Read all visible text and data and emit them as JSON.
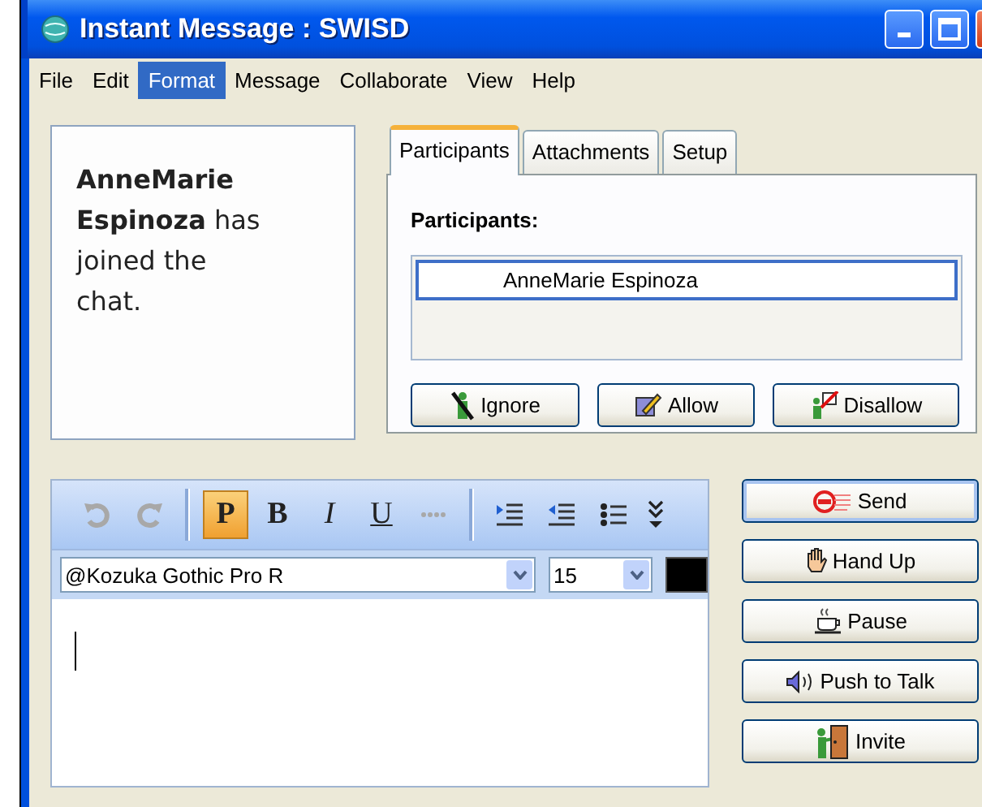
{
  "window": {
    "title": "Instant Message : SWISD"
  },
  "menu": [
    {
      "label": "File",
      "selected": false
    },
    {
      "label": "Edit",
      "selected": false
    },
    {
      "label": "Format",
      "selected": true
    },
    {
      "label": "Message",
      "selected": false
    },
    {
      "label": "Collaborate",
      "selected": false
    },
    {
      "label": "View",
      "selected": false
    },
    {
      "label": "Help",
      "selected": false
    }
  ],
  "chat": {
    "message": "**AnneMarie Espinoza** has joined the chat."
  },
  "tabs": [
    {
      "label": "Participants",
      "selected": true
    },
    {
      "label": "Attachments",
      "selected": false
    },
    {
      "label": "Setup",
      "selected": false
    }
  ],
  "participants": {
    "heading": "Participants:",
    "items": [
      {
        "name": "AnneMarie Espinoza",
        "selected": true
      }
    ],
    "buttons": [
      "Ignore",
      "Allow",
      "Disallow"
    ]
  },
  "toolbar": [
    {
      "kind": "undo",
      "disabled": true,
      "selected": false
    },
    {
      "kind": "redo",
      "disabled": true,
      "selected": false
    },
    {
      "kind": "sep"
    },
    {
      "kind": "plain",
      "label": "P",
      "disabled": false,
      "selected": true
    },
    {
      "kind": "bold",
      "label": "B",
      "disabled": false,
      "selected": false
    },
    {
      "kind": "italic",
      "label": "I",
      "disabled": false,
      "selected": false
    },
    {
      "kind": "underline",
      "label": "U",
      "disabled": false,
      "selected": false
    },
    {
      "kind": "quote",
      "disabled": true,
      "selected": false
    },
    {
      "kind": "sep"
    },
    {
      "kind": "indent",
      "selected": false
    },
    {
      "kind": "outdent",
      "selected": false
    },
    {
      "kind": "bullets",
      "selected": false
    },
    {
      "kind": "more",
      "selected": false
    }
  ],
  "format": {
    "font": "@Kozuka Gothic Pro R",
    "size": "15"
  },
  "actions": [
    "Send",
    "Hand Up",
    "Pause",
    "Push to Talk",
    "Invite"
  ]
}
